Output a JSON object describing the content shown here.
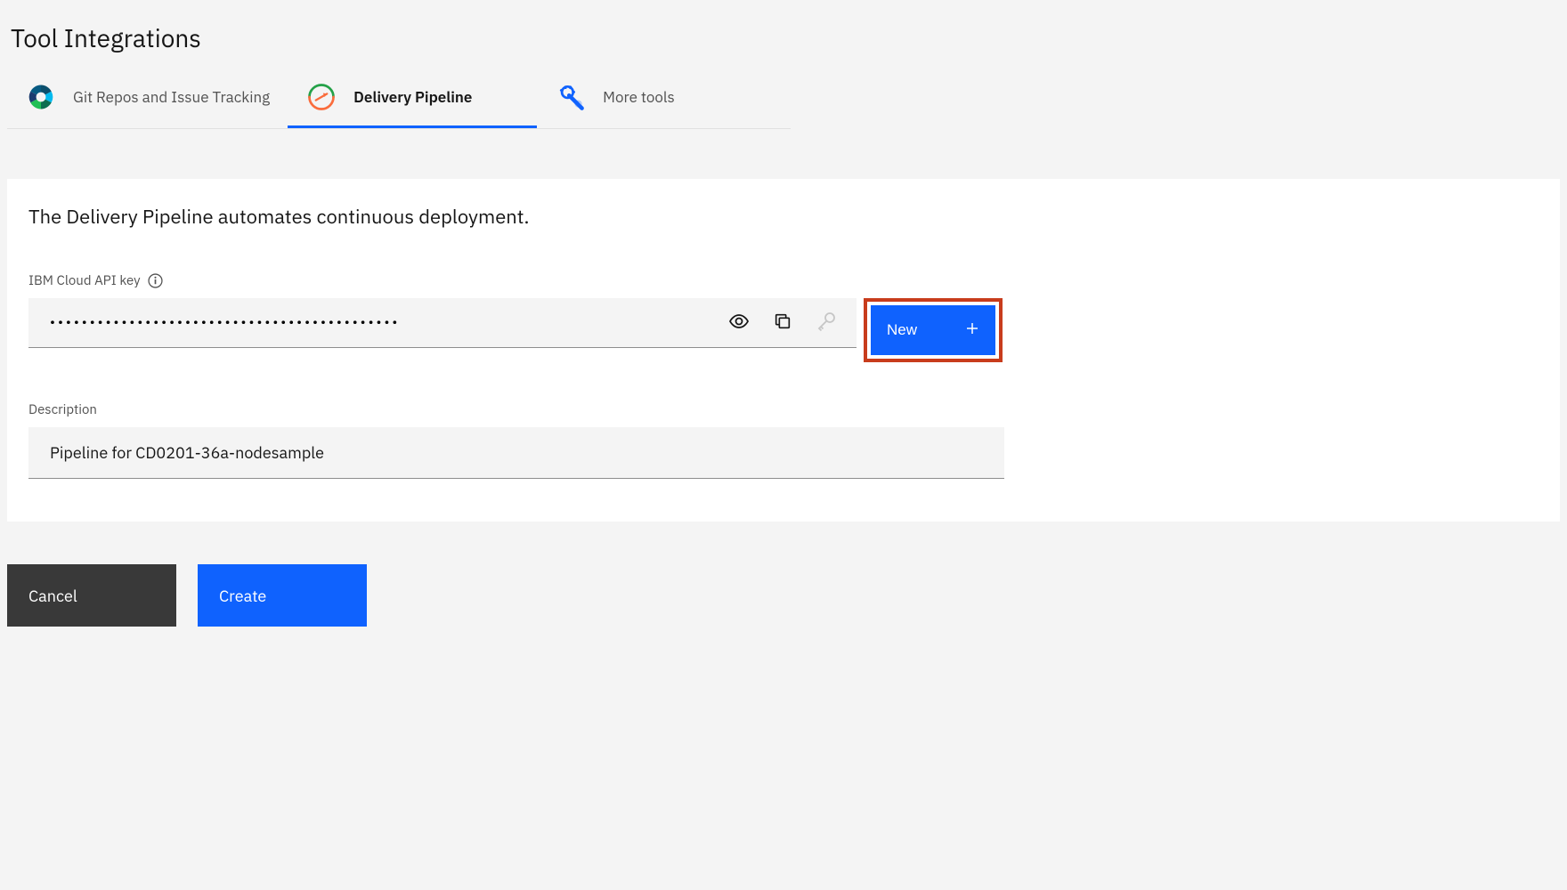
{
  "page_title": "Tool Integrations",
  "tabs": [
    {
      "label": "Git Repos and Issue Tracking",
      "active": false,
      "icon": "donut"
    },
    {
      "label": "Delivery Pipeline",
      "active": true,
      "icon": "pipeline"
    },
    {
      "label": "More tools",
      "active": false,
      "icon": "wrench-gear"
    }
  ],
  "content": {
    "description": "The Delivery Pipeline automates continuous deployment.",
    "api_key": {
      "label": "IBM Cloud API key",
      "value": "••••••••••••••••••••••••••••••••••••••••••••",
      "new_button_label": "New"
    },
    "desc_field": {
      "label": "Description",
      "value": "Pipeline for CD0201-36a-nodesample"
    }
  },
  "footer": {
    "cancel_label": "Cancel",
    "create_label": "Create"
  },
  "colors": {
    "primary": "#0f62fe",
    "highlight_border": "#c83c1c"
  }
}
